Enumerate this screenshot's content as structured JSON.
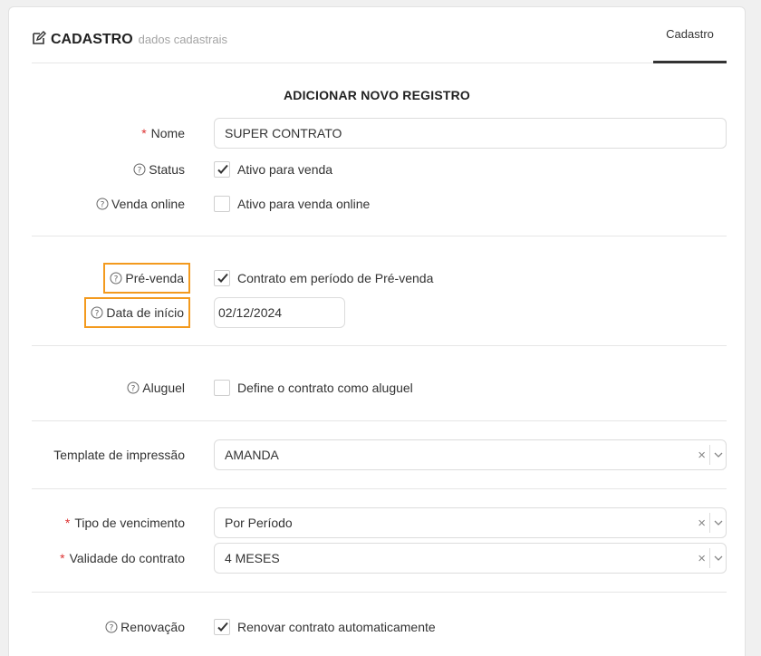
{
  "header": {
    "title": "CADASTRO",
    "subtitle": "dados cadastrais",
    "tab_label": "Cadastro"
  },
  "form_title": "ADICIONAR NOVO REGISTRO",
  "fields": {
    "nome": {
      "required_mark": "*",
      "label": "Nome",
      "value": "SUPER CONTRATO"
    },
    "status": {
      "label": "Status",
      "checkbox_label": "Ativo para venda",
      "checked": true
    },
    "venda_online": {
      "label": "Venda online",
      "checkbox_label": "Ativo para venda online",
      "checked": false
    },
    "pre_venda": {
      "label": "Pré-venda",
      "checkbox_label": "Contrato em período de Pré-venda",
      "checked": true
    },
    "data_inicio": {
      "label": "Data de início",
      "value": "02/12/2024"
    },
    "aluguel": {
      "label": "Aluguel",
      "checkbox_label": "Define o contrato como aluguel",
      "checked": false
    },
    "template": {
      "label": "Template de impressão",
      "value": "AMANDA",
      "clear": "×"
    },
    "tipo_vencimento": {
      "required_mark": "*",
      "label": "Tipo de vencimento",
      "value": "Por Período",
      "clear": "×"
    },
    "validade": {
      "required_mark": "*",
      "label": "Validade do contrato",
      "value": "4 MESES",
      "clear": "×"
    },
    "renovacao": {
      "label": "Renovação",
      "checkbox_label": "Renovar contrato automaticamente",
      "checked": true
    }
  },
  "colors": {
    "highlight": "#f39a1e",
    "required": "#dd3333",
    "tab_underline": "#333333"
  },
  "icons": [
    "edit-icon",
    "help-circle-icon",
    "check-icon",
    "chevron-down-icon"
  ]
}
